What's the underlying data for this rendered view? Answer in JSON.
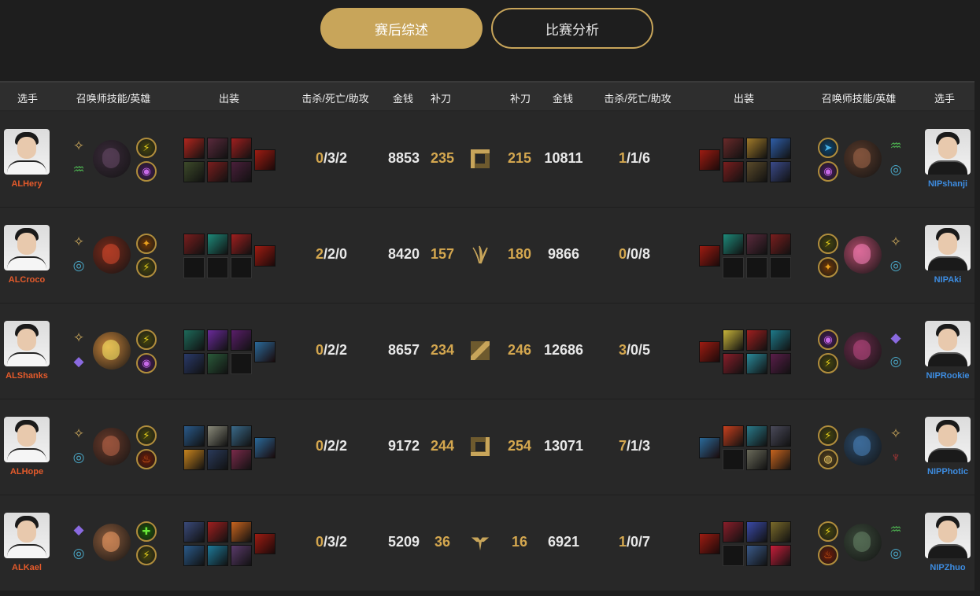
{
  "tabs": [
    {
      "label": "赛后综述",
      "active": true
    },
    {
      "label": "比赛分析",
      "active": false
    }
  ],
  "headers": {
    "player_l": "选手",
    "spells_l": "召唤师技能/英雄",
    "items_l": "出装",
    "kda_l": "击杀/死亡/助攻",
    "gold_l": "金钱",
    "cs_l": "补刀",
    "cs_r": "补刀",
    "gold_r": "金钱",
    "kda_r": "击杀/死亡/助攻",
    "items_r": "出装",
    "spells_r": "召唤师技能/英雄",
    "player_r": "选手"
  },
  "colors": {
    "accent_gold": "#c8a55a",
    "team_left": "#e45a2b",
    "team_right": "#3d8ce0"
  },
  "rows": [
    {
      "lane": "top",
      "lane_icon": "top-lane-icon",
      "left": {
        "player": "ALHery",
        "k": "0",
        "rest": "/3/2",
        "gold": "8853",
        "cs": "235",
        "rune_primary": "precision-rune-icon",
        "rune_secondary": "resolve-rune-icon",
        "champ_color": "#3a2a3a",
        "spells": [
          "ghost-spell-icon",
          "teleport-spell-icon"
        ],
        "items": [
          "#b3261e",
          "#5a2a3c",
          "#a01f1f",
          "#3d4a2a",
          "#7a1e1e",
          "#4a1f3a"
        ],
        "trinket": "#9e1c12"
      },
      "right": {
        "player": "NIPshanji",
        "k": "1",
        "rest": "/1/6",
        "gold": "10811",
        "cs": "215",
        "rune_primary": "resolve-rune-icon",
        "rune_secondary": "inspiration-rune-icon",
        "champ_color": "#5a3a2a",
        "spells": [
          "flash-spell-icon",
          "teleport-spell-icon"
        ],
        "items": [
          "#2f5ea8",
          "#a07a2a",
          "#6a2a2a",
          "#3a4a8a",
          "#5a4a2a",
          "#7a1e1e"
        ],
        "trinket": "#9e1c12"
      }
    },
    {
      "lane": "jungle",
      "lane_icon": "jungle-lane-icon",
      "left": {
        "player": "ALCroco",
        "k": "2",
        "rest": "/2/0",
        "gold": "8420",
        "cs": "157",
        "rune_primary": "precision-rune-icon",
        "rune_secondary": "inspiration-rune-icon",
        "champ_color": "#7a2a1a",
        "spells": [
          "smite-spell-icon",
          "ghost-spell-icon"
        ],
        "items": [
          "#7a1e1e",
          "#1e8a7a",
          "#a01f1f",
          "",
          "",
          ""
        ],
        "trinket": "#9e1c12"
      },
      "right": {
        "player": "NIPAki",
        "k": "0",
        "rest": "/0/8",
        "gold": "9866",
        "cs": "180",
        "rune_primary": "precision-rune-icon",
        "rune_secondary": "inspiration-rune-icon",
        "champ_color": "#b04a6a",
        "spells": [
          "ghost-spell-icon",
          "smite-spell-icon"
        ],
        "items": [
          "#7a1e1e",
          "#5a2a3c",
          "#1e8a7a",
          "",
          "",
          ""
        ],
        "trinket": "#9e1c12"
      }
    },
    {
      "lane": "mid",
      "lane_icon": "mid-lane-icon",
      "left": {
        "player": "ALShanks",
        "k": "0",
        "rest": "/2/2",
        "gold": "8657",
        "cs": "234",
        "rune_primary": "precision-rune-icon",
        "rune_secondary": "sorcery-rune-icon",
        "champ_color": "#c8843a",
        "spells": [
          "ghost-spell-icon",
          "teleport-spell-icon"
        ],
        "items": [
          "#1e6a5a",
          "#6a2a9a",
          "#5a1e6a",
          "#2a3a6a",
          "#2a5a3a",
          ""
        ],
        "trinket": "#2a6a9a"
      },
      "right": {
        "player": "NIPRookie",
        "k": "3",
        "rest": "/0/5",
        "gold": "12686",
        "cs": "246",
        "rune_primary": "sorcery-rune-icon",
        "rune_secondary": "inspiration-rune-icon",
        "champ_color": "#6a2a4a",
        "spells": [
          "teleport-spell-icon",
          "ghost-spell-icon"
        ],
        "items": [
          "#1e7a8a",
          "#a01f1f",
          "#c8b43a",
          "#5a1e4a",
          "#2a8a9a",
          "#8a1e2a"
        ],
        "trinket": "#9e1c12"
      }
    },
    {
      "lane": "bot",
      "lane_icon": "bot-lane-icon",
      "left": {
        "player": "ALHope",
        "k": "0",
        "rest": "/2/2",
        "gold": "9172",
        "cs": "244",
        "rune_primary": "precision-rune-icon",
        "rune_secondary": "inspiration-rune-icon",
        "champ_color": "#6a3a2a",
        "spells": [
          "ghost-spell-icon",
          "ignite-spell-icon"
        ],
        "items": [
          "#2a5a8a",
          "#8a8a7a",
          "#3a6a8a",
          "#c8841e",
          "#2a3a5a",
          "#7a2a4a"
        ],
        "trinket": "#2a6a9a"
      },
      "right": {
        "player": "NIPPhotic",
        "k": "7",
        "rest": "/1/3",
        "gold": "13071",
        "cs": "254",
        "rune_primary": "precision-rune-icon",
        "rune_secondary": "domination-rune-icon",
        "champ_color": "#2a4a6a",
        "spells": [
          "ghost-spell-icon",
          "barrier-spell-icon"
        ],
        "items": [
          "#4a4a5a",
          "#2a7a8a",
          "#c8401e",
          "#c8641e",
          "#6a6a5a",
          ""
        ],
        "trinket": "#2a6a9a"
      }
    },
    {
      "lane": "support",
      "lane_icon": "support-lane-icon",
      "left": {
        "player": "ALKael",
        "k": "0",
        "rest": "/3/2",
        "gold": "5209",
        "cs": "36",
        "rune_primary": "sorcery-rune-icon",
        "rune_secondary": "inspiration-rune-icon",
        "champ_color": "#8a5a3a",
        "spells": [
          "heal-spell-icon",
          "ghost-spell-icon"
        ],
        "items": [
          "#3a4a7a",
          "#a01f1f",
          "#c8641e",
          "#2a5a8a",
          "#1e7a9a",
          "#5a3a6a"
        ],
        "trinket": "#9e1c12"
      },
      "right": {
        "player": "NIPZhuo",
        "k": "1",
        "rest": "/0/7",
        "gold": "6921",
        "cs": "16",
        "rune_primary": "resolve-rune-icon",
        "rune_secondary": "inspiration-rune-icon",
        "champ_color": "#3a4a3a",
        "spells": [
          "ghost-spell-icon",
          "ignite-spell-icon"
        ],
        "items": [
          "#7a6a2a",
          "#3a4aa8",
          "#8a1e2a",
          "#c81e3a",
          "#3a5a8a",
          ""
        ],
        "trinket": "#9e1c12"
      }
    }
  ]
}
